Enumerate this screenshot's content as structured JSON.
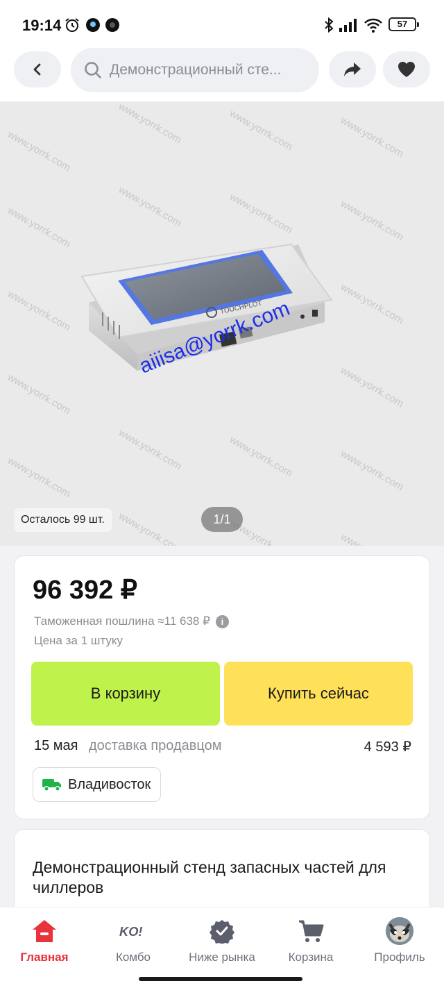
{
  "status_bar": {
    "time": "19:14",
    "battery": "57"
  },
  "header": {
    "search_text": "Демонстрационный сте..."
  },
  "gallery": {
    "stock": "Осталось 99 шт.",
    "pager": "1/1",
    "watermark_email": "aiiisa@yorrk.com",
    "watermark_site": "www.yorrk.com",
    "device_brand": "TOUCHPLOT"
  },
  "offer": {
    "price": "96 392 ₽",
    "duty": "Таможенная пошлина ≈11 638 ₽",
    "unit_price": "Цена за 1 штуку",
    "cart_button": "В корзину",
    "buy_button": "Купить сейчас",
    "delivery_date": "15 мая",
    "delivery_type": "доставка продавцом",
    "delivery_price": "4 593 ₽",
    "city": "Владивосток"
  },
  "product": {
    "title": "Демонстрационный стенд запасных частей для чиллеров"
  },
  "bottom_nav": {
    "home": "Главная",
    "combo": "Комбо",
    "below_market": "Ниже рынка",
    "cart": "Корзина",
    "profile": "Профиль"
  },
  "colors": {
    "cart_button": "#bff24a",
    "buy_button": "#ffe159",
    "active_tab": "#e8323c"
  }
}
